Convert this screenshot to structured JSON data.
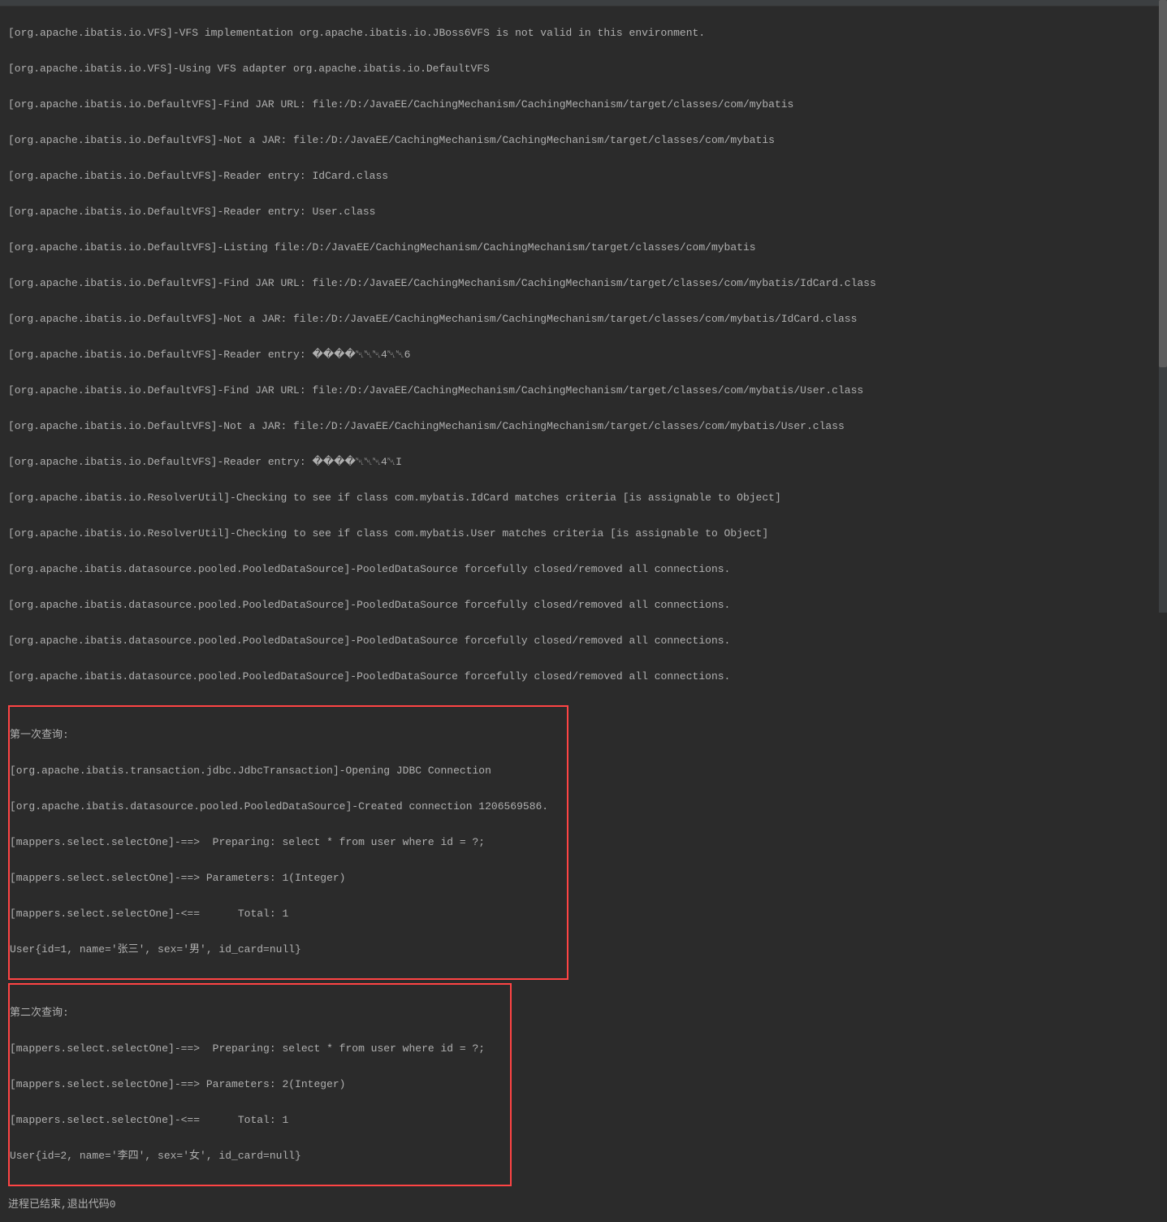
{
  "logs": {
    "preamble": [
      "[org.apache.ibatis.io.VFS]-VFS implementation org.apache.ibatis.io.JBoss6VFS is not valid in this environment.",
      "[org.apache.ibatis.io.VFS]-Using VFS adapter org.apache.ibatis.io.DefaultVFS",
      "[org.apache.ibatis.io.DefaultVFS]-Find JAR URL: file:/D:/JavaEE/CachingMechanism/CachingMechanism/target/classes/com/mybatis",
      "[org.apache.ibatis.io.DefaultVFS]-Not a JAR: file:/D:/JavaEE/CachingMechanism/CachingMechanism/target/classes/com/mybatis",
      "[org.apache.ibatis.io.DefaultVFS]-Reader entry: IdCard.class",
      "[org.apache.ibatis.io.DefaultVFS]-Reader entry: User.class",
      "[org.apache.ibatis.io.DefaultVFS]-Listing file:/D:/JavaEE/CachingMechanism/CachingMechanism/target/classes/com/mybatis",
      "[org.apache.ibatis.io.DefaultVFS]-Find JAR URL: file:/D:/JavaEE/CachingMechanism/CachingMechanism/target/classes/com/mybatis/IdCard.class",
      "[org.apache.ibatis.io.DefaultVFS]-Not a JAR: file:/D:/JavaEE/CachingMechanism/CachingMechanism/target/classes/com/mybatis/IdCard.class",
      "[org.apache.ibatis.io.DefaultVFS]-Reader entry: ����␀␀␀4␀␀6",
      "[org.apache.ibatis.io.DefaultVFS]-Find JAR URL: file:/D:/JavaEE/CachingMechanism/CachingMechanism/target/classes/com/mybatis/User.class",
      "[org.apache.ibatis.io.DefaultVFS]-Not a JAR: file:/D:/JavaEE/CachingMechanism/CachingMechanism/target/classes/com/mybatis/User.class",
      "[org.apache.ibatis.io.DefaultVFS]-Reader entry: ����␀␀␀4␀I",
      "[org.apache.ibatis.io.ResolverUtil]-Checking to see if class com.mybatis.IdCard matches criteria [is assignable to Object]",
      "[org.apache.ibatis.io.ResolverUtil]-Checking to see if class com.mybatis.User matches criteria [is assignable to Object]",
      "[org.apache.ibatis.datasource.pooled.PooledDataSource]-PooledDataSource forcefully closed/removed all connections.",
      "[org.apache.ibatis.datasource.pooled.PooledDataSource]-PooledDataSource forcefully closed/removed all connections.",
      "[org.apache.ibatis.datasource.pooled.PooledDataSource]-PooledDataSource forcefully closed/removed all connections.",
      "[org.apache.ibatis.datasource.pooled.PooledDataSource]-PooledDataSource forcefully closed/removed all connections."
    ],
    "query1": {
      "header": "第一次查询:",
      "lines": [
        "[org.apache.ibatis.transaction.jdbc.JdbcTransaction]-Opening JDBC Connection",
        "[org.apache.ibatis.datasource.pooled.PooledDataSource]-Created connection 1206569586.",
        "[mappers.select.selectOne]-==>  Preparing: select * from user where id = ?;",
        "[mappers.select.selectOne]-==> Parameters: 1(Integer)",
        "[mappers.select.selectOne]-<==      Total: 1",
        "User{id=1, name='张三', sex='男', id_card=null}"
      ]
    },
    "query2": {
      "header": "第二次查询:",
      "lines": [
        "[mappers.select.selectOne]-==>  Preparing: select * from user where id = ?;",
        "[mappers.select.selectOne]-==> Parameters: 2(Integer)",
        "[mappers.select.selectOne]-<==      Total: 1",
        "User{id=2, name='李四', sex='女', id_card=null}"
      ]
    }
  },
  "footer": "进程已结束,退出代码0"
}
